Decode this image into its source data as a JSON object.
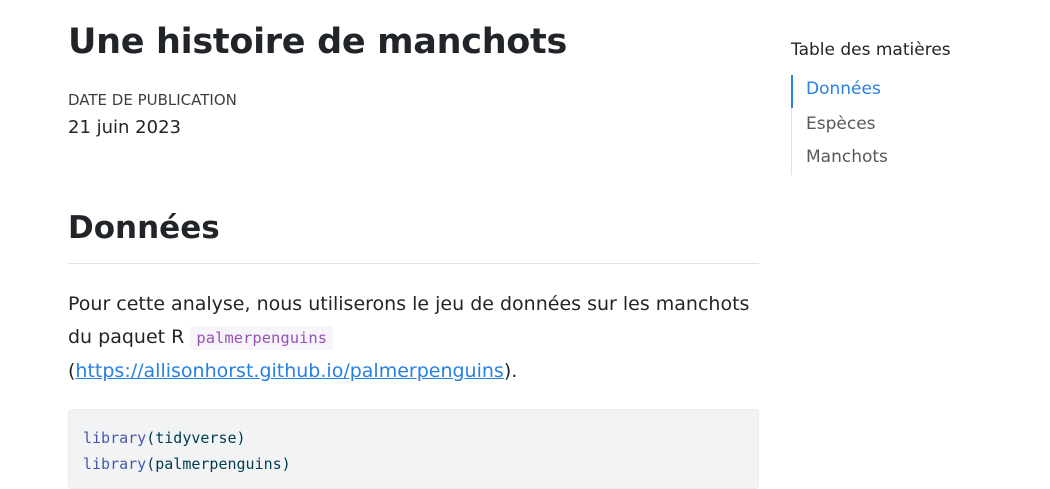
{
  "article": {
    "title": "Une histoire de manchots",
    "date_label": "DATE DE PUBLICATION",
    "date_value": "21 juin 2023"
  },
  "section": {
    "heading": "Données",
    "para_text_1": "Pour cette analyse, nous utiliserons le jeu de données sur les manchots du paquet R ",
    "para_code": "palmerpenguins",
    "para_paren_open": "(",
    "para_link": "https://allisonhorst.github.io/palmerpenguins",
    "para_paren_close": ")."
  },
  "code": {
    "line1_fn": "library",
    "line1_arg": "(tidyverse)",
    "line2_fn": "library",
    "line2_arg": "(palmerpenguins)"
  },
  "toc": {
    "title": "Table des matières",
    "items": [
      {
        "label": "Données",
        "active": true
      },
      {
        "label": "Espèces",
        "active": false
      },
      {
        "label": "Manchots",
        "active": false
      }
    ]
  },
  "colors": {
    "link": "#2780e3",
    "code_inline": "#9753b8",
    "text": "#212529"
  }
}
